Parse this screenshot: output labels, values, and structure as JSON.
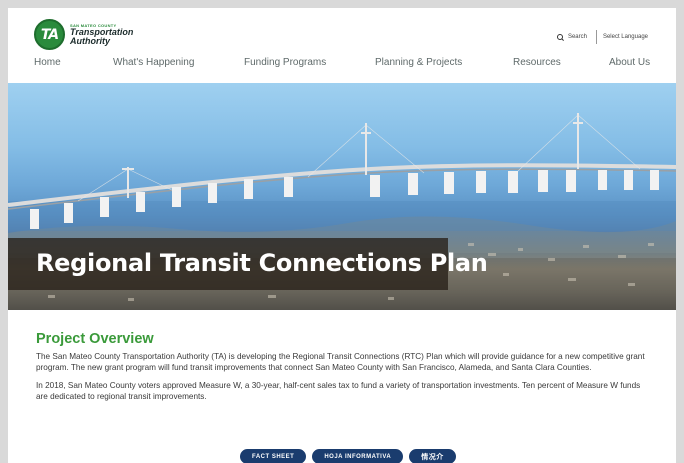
{
  "header": {
    "logo": {
      "badge": "TA",
      "small_line": "SAN MATEO COUNTY",
      "line1": "Transportation",
      "line2": "Authority"
    },
    "search_label": "Search",
    "language_label": "Select Language"
  },
  "nav": {
    "items": [
      {
        "label": "Home"
      },
      {
        "label": "What's Happening"
      },
      {
        "label": "Funding Programs"
      },
      {
        "label": "Planning & Projects"
      },
      {
        "label": "Resources"
      },
      {
        "label": "About Us"
      }
    ]
  },
  "hero": {
    "title": "Regional Transit Connections Plan"
  },
  "overview": {
    "title": "Project Overview",
    "paragraph1": "The San Mateo County Transportation Authority (TA) is developing the Regional Transit Connections (RTC) Plan which will provide guidance for a new competitive grant program. The new grant program will fund transit improvements that connect San Mateo County with San Francisco, Alameda, and Santa Clara Counties.",
    "paragraph2": "In 2018, San Mateo County voters approved Measure W, a 30-year, half-cent sales tax to fund a variety of transportation investments. Ten percent of Measure W funds are dedicated to regional transit improvements."
  },
  "buttons": {
    "fact_sheet": "FACT SHEET",
    "hoja": "HOJA INFORMATIVA",
    "chinese": "情况介"
  },
  "colors": {
    "accent_green": "#3a9a3a",
    "button_navy": "#1a3c6e",
    "nav_text": "#5f6a6a"
  }
}
